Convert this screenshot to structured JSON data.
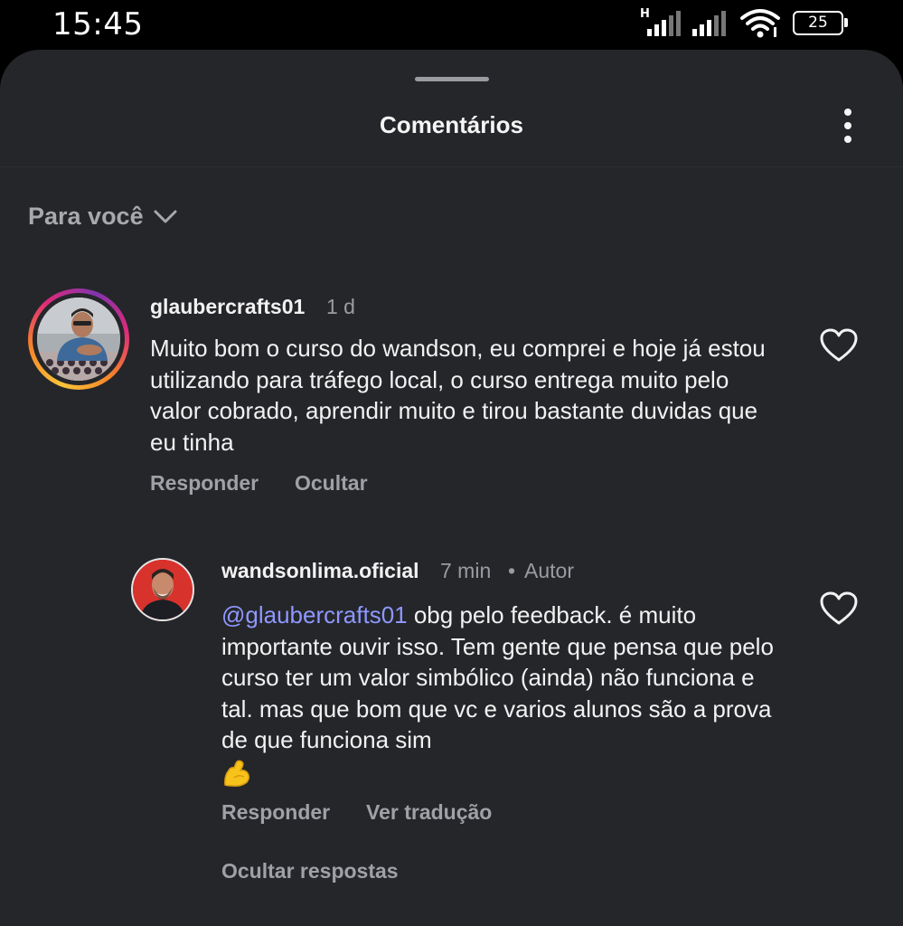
{
  "status_bar": {
    "time": "15:45",
    "network_type": "H",
    "battery": "25",
    "icons": [
      "signal-icon",
      "signal-icon",
      "wifi-icon",
      "battery-icon"
    ]
  },
  "sheet": {
    "title": "Comentários",
    "sort_label": "Para você",
    "icons": [
      "more-vertical-icon",
      "chevron-down-icon"
    ]
  },
  "comments": [
    {
      "username": "glaubercrafts01",
      "time": "1 d",
      "text": "Muito bom o curso do wandson, eu comprei e hoje já estou utilizando para tráfego local, o curso entrega muito pelo valor cobrado, aprendir muito e tirou bastante duvidas que eu tinha",
      "actions": [
        "Responder",
        "Ocultar"
      ]
    }
  ],
  "replies": [
    {
      "username": "wandsonlima.oficial",
      "time": "7 min",
      "separator": "•",
      "badge": "Autor",
      "mention": "@glaubercrafts01",
      "text": " obg pelo feedback. é muito importante ouvir isso. Tem gente que pensa que pelo curso ter um valor simbólico (ainda) não funciona e tal. mas que bom que vc e varios alunos são a prova de que funciona sim",
      "actions": [
        "Responder",
        "Ver tradução"
      ]
    }
  ],
  "hide_replies_label": "Ocultar respostas",
  "colors": {
    "sheet_bg": "#25262a",
    "mention": "#8e98ff",
    "secondary_text": "#9b9ca1"
  }
}
